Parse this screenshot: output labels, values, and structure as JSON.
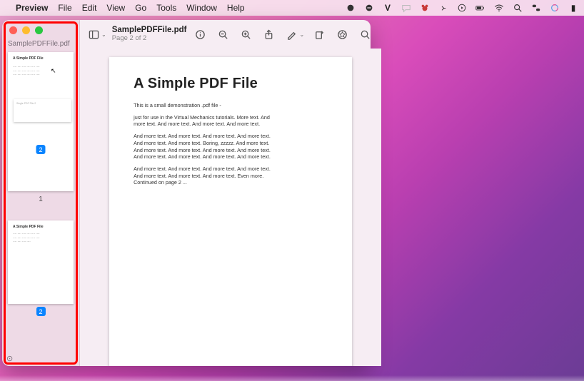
{
  "menubar": {
    "app_name": "Preview",
    "items": [
      "File",
      "Edit",
      "View",
      "Go",
      "Tools",
      "Window",
      "Help"
    ]
  },
  "menubar_right": {
    "icons": [
      "record",
      "dnd",
      "letter-v",
      "bear",
      "bluetooth",
      "play-circle",
      "battery",
      "wifi",
      "search-spotlight",
      "control-center",
      "siri",
      "menu"
    ]
  },
  "window": {
    "filename": "SamplePDFFile.pdf",
    "subtitle": "Page 2 of 2",
    "sidebar_filename": "SamplePDFFile.pdf",
    "thumbs": [
      {
        "badge": "2",
        "label": "1",
        "overlay_title": "Single PDF File 2"
      },
      {
        "badge": "2"
      }
    ],
    "thumb_preview": {
      "heading": "A Simple PDF File",
      "lines": "Lorem-like small demonstration text block used for thumbnail preview."
    }
  },
  "document": {
    "heading": "A Simple PDF File",
    "p1": "This is a small demonstration .pdf file -",
    "p2": "just for use in the Virtual Mechanics tutorials. More text. And more text. And more text. And more text. And more text.",
    "p3": "And more text. And more text. And more text. And more text. And more text. And more text. Boring, zzzzz. And more text. And more text. And more text. And more text. And more text. And more text. And more text. And more text. And more text.",
    "p4": "And more text. And more text. And more text. And more text. And more text. And more text. And more text. Even more. Continued on page 2 ..."
  },
  "toolbar": {
    "view_mode": "sidebar",
    "actions": [
      "info",
      "zoom-out",
      "zoom-in",
      "share",
      "markup",
      "markup-options",
      "rotate",
      "highlight",
      "search"
    ]
  }
}
